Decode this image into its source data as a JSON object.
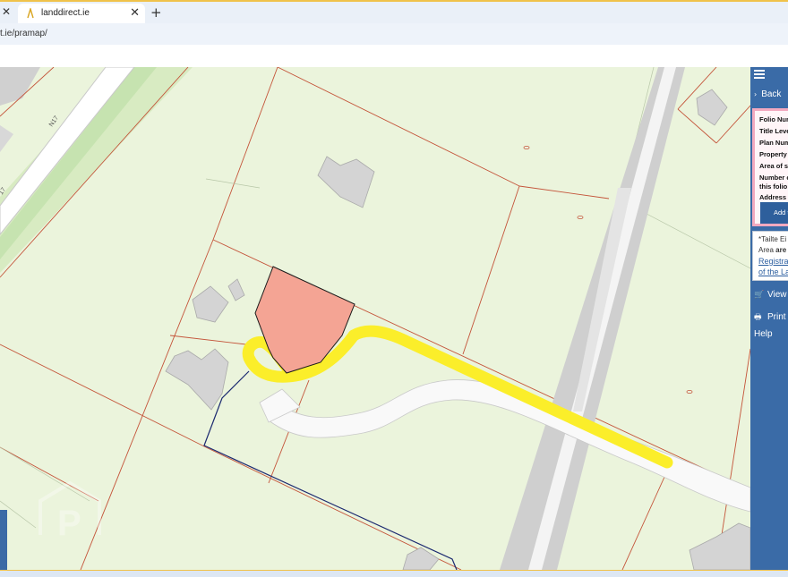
{
  "browser": {
    "tab_title": "landdirect.ie",
    "tab_close": "✕",
    "new_tab": "+",
    "left_close": "✕",
    "url": "t.ie/pramap/"
  },
  "map": {
    "road_label": "N17",
    "road_label_2": "17",
    "watermark": "P"
  },
  "panel": {
    "back_label": "Back",
    "info_rows": [
      "Folio Nur",
      "Title Leve",
      "Plan Num",
      "Property",
      "Area of s",
      "Number c",
      "this folio",
      "Address"
    ],
    "add_button": "Add t",
    "note_line1": "*Tailte Ei",
    "note_line2_pre": "Area ",
    "note_line2_bold": "are n",
    "note_link1": "Registrat",
    "note_link2": "of the La",
    "view_label": "View",
    "print_label": "Print",
    "help_label": "Help"
  },
  "colors": {
    "map_bg": "#ebf4dc",
    "panel_bg": "#3a6ba7",
    "selected_parcel": "#f4a494",
    "access_route": "#fbee2a",
    "boundary_line": "#c4543a",
    "folio_outline": "#1c2a70"
  }
}
